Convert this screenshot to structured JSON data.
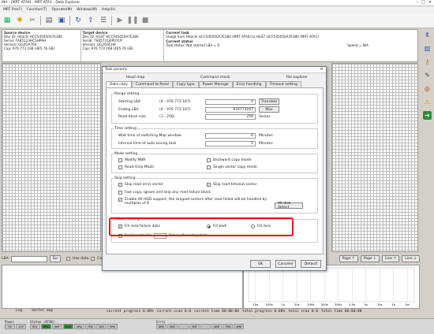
{
  "window": {
    "title": "Mrt - [MRT ATA0] - MRT ATA1 - Data Explorer",
    "controls": [
      "–",
      "□",
      "×"
    ]
  },
  "menu": [
    "MRT Pro(F)",
    "Function(T)",
    "Operate(M)",
    "Window(W)",
    "Help(H)"
  ],
  "info": {
    "source_hdr": "Source device",
    "source_lines": [
      "Dev ID: Hitachi HCC545050A7E380",
      "Serial: TA85123HC5HPAH",
      "Version: GG2OA760",
      "Cap: 976 773 168 (465.76 GB)"
    ],
    "target_hdr": "Target device",
    "target_lines": [
      "Dev ID: HGST HCC545050A7E380",
      "Serial: TE85731J6PUYUF",
      "Version: GG2OACH8",
      "Cap: 976 773 168 (465.76 GB)"
    ],
    "task_hdr": "Current task",
    "task_line": "Image from Hitachi HCC545050A7E380 (MRT ATA0) to HGST HCC545050A7E380 (MRT ATA1)",
    "status_hdr": "Current status",
    "status_line": "Task status: Not started  LBA = 0",
    "speed_line": "Speed = N/A"
  },
  "lba_bar": {
    "label": "LBA",
    "go": "Go",
    "hex_label": "Hex data",
    "cop_label": "Cop",
    "page_btns": [
      "Page ↑",
      "Page ↓",
      "Line ↑",
      "Line ↓"
    ]
  },
  "bottom_tabs": [
    "Log",
    "Sector map"
  ],
  "progress": {
    "current": "current progress 0.00%",
    "current_scan": "current scan  0.0",
    "current_time": "current time  00:00:00",
    "total": "total progress 0.00%",
    "total_scan": "total scan 0.0",
    "total_time": "total time 00:00:00"
  },
  "chart_axis": [
    "10s",
    "100s",
    "1s",
    "10s",
    "100s",
    "200s",
    "500s",
    "1.5s",
    "5s",
    "10s",
    "1h",
    "5d"
  ],
  "status": {
    "power_label": "Power",
    "power_cells": [
      "5V",
      "12V"
    ],
    "status_label": "Status (ATA0)",
    "status_cells": [
      "BSY",
      "DRD",
      "DWF",
      "DSC",
      "DRQ",
      "CRR",
      "IDX",
      "ERR"
    ],
    "error_label": "Error",
    "error_cells": [
      "BBK",
      "UNC",
      "",
      "INF",
      "",
      "ABR",
      "T0N",
      "AMN"
    ]
  },
  "dialog": {
    "title": "Task params",
    "close": "×",
    "tabs_row1": [
      "Head map",
      "Command check",
      "File explorer"
    ],
    "tabs_row2": [
      "Data copy",
      "Command to Read",
      "Copy type",
      "Power Manage",
      "Error handling",
      "Timeout setting"
    ],
    "range": {
      "label": "Range setting",
      "start_label": "Starting LBA",
      "start_range": "(0 - 976 773 167)",
      "start_val": "0",
      "translate": "Translate",
      "end_label": "Ending LBA",
      "end_range": "(0 - 976 773 167)",
      "end_val": "976773167",
      "max": "Max",
      "block_label": "Read block size",
      "block_range": "(1 - 256)",
      "block_val": "256",
      "block_unit": "Sector"
    },
    "time": {
      "label": "Time setting",
      "wait_label": "Wait time of switching Map window",
      "wait_val": "0",
      "wait_unit": "Minutes",
      "interval_label": "Interval time of auto saving task",
      "interval_val": "1",
      "interval_unit": "Minutes"
    },
    "mode": {
      "label": "Mode setting",
      "modify_mbr": "Modify MBR",
      "backward": "Backward copy mode",
      "read_only": "Read-Only Mode",
      "single": "Single sector copy mode"
    },
    "skip": {
      "label": "Skip setting",
      "skip_err": "Skip read error sector",
      "skip_timeout": "Skip read timeout sector",
      "fast_copy": "Fast copy, ignore and skip any read failure block",
      "enable4k_1": "Enable 4K HDD support, the skipped sectors after read failed will be handled by",
      "enable4k_2": "multiples of 8",
      "disk4k": "4K disk detect"
    },
    "failure": {
      "label": "Failure setting",
      "fill": "Fill read failure data",
      "fill_bad": "Fill bad!",
      "fill_zero": "Fill zero",
      "read_sector": "Read sector fai",
      "times": "Times ,then stop task"
    },
    "buttons": [
      "OK",
      "Canceler",
      "Default"
    ]
  },
  "colors": {
    "highlight": "#e0161b",
    "status_green": "#2e8b3a",
    "status_grey": "#bfbfbf"
  }
}
